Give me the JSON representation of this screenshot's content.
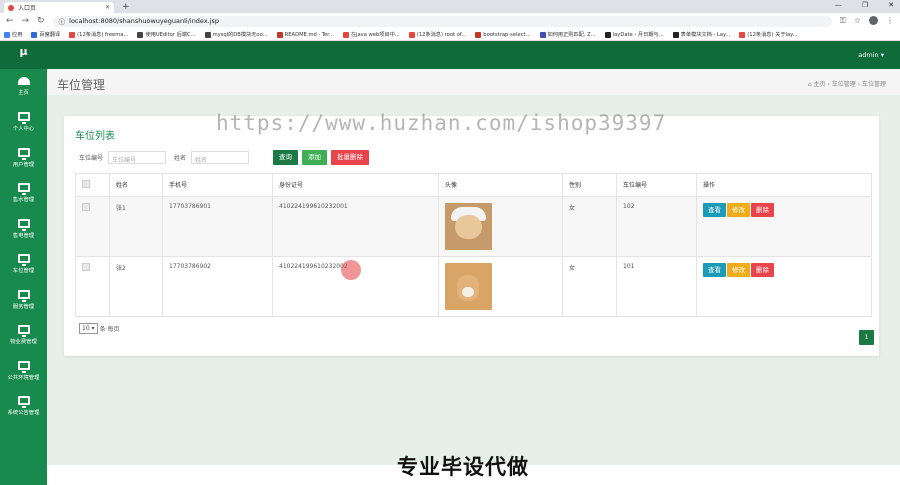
{
  "browser": {
    "tab_title": "入口页",
    "url": "localhost:8080/shanshuowuyeguanli/index.jsp",
    "bookmarks": [
      {
        "label": "应用",
        "color": "#4285f4"
      },
      {
        "label": "百度翻译",
        "color": "#2f6bd8"
      },
      {
        "label": "(12条消息) freema...",
        "color": "#e8453c"
      },
      {
        "label": "使用UEditor 后端C...",
        "color": "#444"
      },
      {
        "label": "mysql的DB模块无oo...",
        "color": "#444"
      },
      {
        "label": "README.md · Ter...",
        "color": "#c0392b"
      },
      {
        "label": "在java web项目中...",
        "color": "#e8453c"
      },
      {
        "label": "(12条消息) root of...",
        "color": "#e8453c"
      },
      {
        "label": "bootstrap-select...",
        "color": "#c0392b"
      },
      {
        "label": "如何用正则匹配, Z...",
        "color": "#3f51b5"
      },
      {
        "label": "layDate - 月日期与...",
        "color": "#222"
      },
      {
        "label": "表单模块文档 - Lay...",
        "color": "#222"
      },
      {
        "label": "(12条消息) 关于lay...",
        "color": "#e8453c"
      }
    ]
  },
  "sidebar": {
    "logo": "μ",
    "items": [
      {
        "label": "主页"
      },
      {
        "label": "个人中心"
      },
      {
        "label": "用户管理"
      },
      {
        "label": "售水管理"
      },
      {
        "label": "售电管理"
      },
      {
        "label": "车位管理"
      },
      {
        "label": "服务管理"
      },
      {
        "label": "物业费管理"
      },
      {
        "label": "公共环境管理"
      },
      {
        "label": "系统公告管理"
      }
    ]
  },
  "topbar": {
    "user": "admin ▾"
  },
  "header": {
    "title": "车位管理",
    "breadcrumb": "⌂ 主页 › 车位管理 › 车位管理"
  },
  "card": {
    "title": "车位列表",
    "search": {
      "label1": "车位编号",
      "placeholder1": "车位编号",
      "label2": "姓名",
      "placeholder2": "姓名",
      "query": "查询",
      "add": "添加",
      "batch_delete": "批量删除"
    },
    "columns": [
      "",
      "姓名",
      "手机号",
      "身份证号",
      "头像",
      "性别",
      "车位编号",
      "操作"
    ],
    "rows": [
      {
        "name": "张1",
        "phone": "17703786901",
        "idcard": "410224199610232001",
        "gender": "女",
        "spot": "102"
      },
      {
        "name": "张2",
        "phone": "17703786902",
        "idcard": "410224199610232002",
        "gender": "女",
        "spot": "101"
      }
    ],
    "ops": {
      "view": "查看",
      "edit": "修改",
      "delete": "删除"
    },
    "pager": {
      "size": "10 ▾",
      "suffix": "条 每页",
      "page": "1"
    }
  },
  "watermark": "https://www.huzhan.com/ishop39397",
  "overlay": "专业毕设代做"
}
